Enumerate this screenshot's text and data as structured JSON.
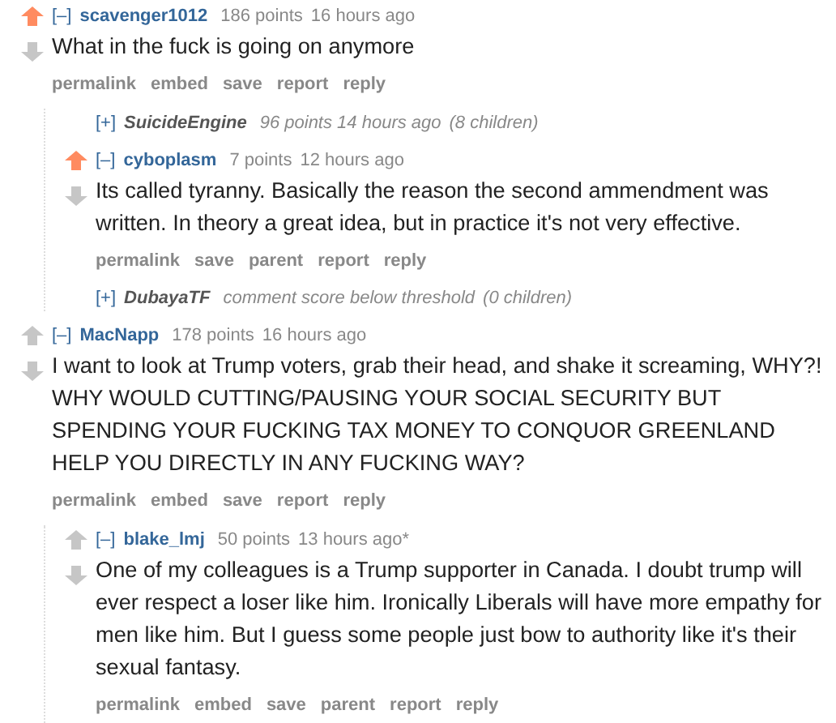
{
  "comments": [
    {
      "kind": "comment",
      "toggle": "[–]",
      "author": "scavenger1012",
      "score": "186 points",
      "time": "16 hours ago",
      "upvoted": true,
      "body": [
        "What in the fuck is going on anymore"
      ],
      "buttons": [
        "permalink",
        "embed",
        "save",
        "report",
        "reply"
      ],
      "children": [
        {
          "kind": "collapsed",
          "toggle": "[+]",
          "author": "SuicideEngine",
          "score": "96 points 14 hours ago",
          "count": "(8 children)"
        },
        {
          "kind": "comment",
          "toggle": "[–]",
          "author": "cyboplasm",
          "score": "7 points",
          "time": "12 hours ago",
          "upvoted": true,
          "body": [
            "Its called tyranny. Basically the reason the second ammendment was written. In theory a great idea, but in practice it's not very effective."
          ],
          "buttons": [
            "permalink",
            "save",
            "parent",
            "report",
            "reply"
          ]
        },
        {
          "kind": "collapsed",
          "toggle": "[+]",
          "author": "DubayaTF",
          "score": "comment score below threshold",
          "count": "(0 children)"
        }
      ]
    },
    {
      "kind": "comment",
      "toggle": "[–]",
      "author": "MacNapp",
      "score": "178 points",
      "time": "16 hours ago",
      "upvoted": false,
      "body": [
        "I want to look at Trump voters, grab their head, and shake it screaming, WHY?! WHY WOULD CUTTING/PAUSING YOUR SOCIAL SECURITY BUT SPENDING YOUR FUCKING TAX MONEY TO CONQUOR GREENLAND HELP YOU DIRECTLY IN ANY FUCKING WAY?"
      ],
      "buttons": [
        "permalink",
        "embed",
        "save",
        "report",
        "reply"
      ],
      "children": [
        {
          "kind": "comment",
          "toggle": "[–]",
          "author": "blake_lmj",
          "score": "50 points",
          "time": "13 hours ago*",
          "upvoted": false,
          "body": [
            "One of my colleagues is a Trump supporter in Canada. I doubt trump will ever respect a loser like him. Ironically Liberals will have more empathy for men like him. But I guess some people just bow to authority like it's their sexual fantasy."
          ],
          "buttons": [
            "permalink",
            "embed",
            "save",
            "parent",
            "report",
            "reply"
          ]
        }
      ]
    }
  ]
}
